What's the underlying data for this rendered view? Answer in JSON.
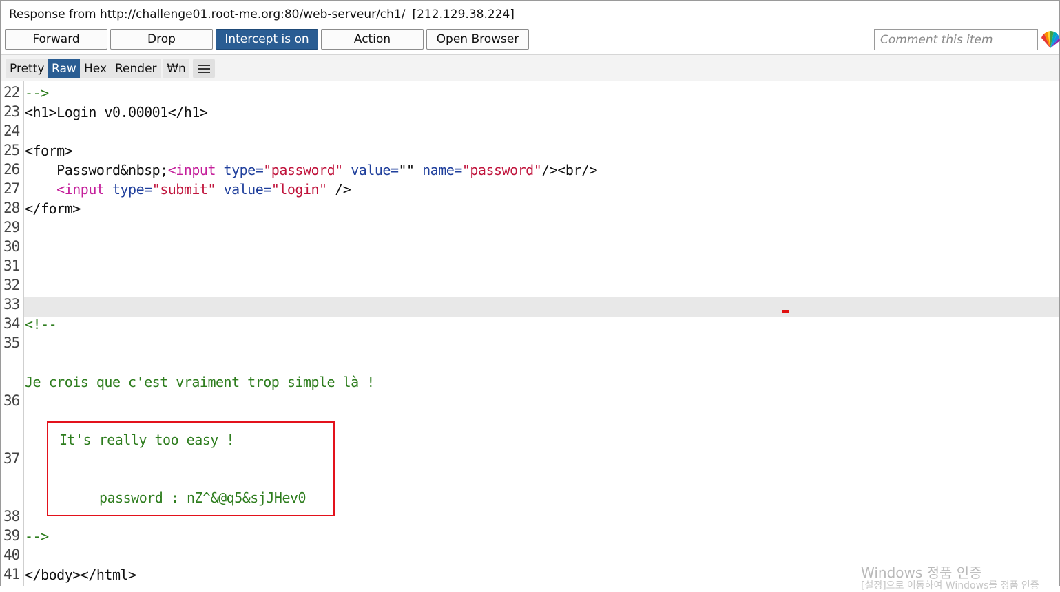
{
  "header": {
    "response_title": "Response from http://challenge01.root-me.org:80/web-serveur/ch1/",
    "ip": "[212.129.38.224]"
  },
  "toolbar": {
    "forward": "Forward",
    "drop": "Drop",
    "intercept": "Intercept is on",
    "action": "Action",
    "open_browser": "Open Browser",
    "comment_placeholder": "Comment this item"
  },
  "view_tabs": {
    "pretty": "Pretty",
    "raw": "Raw",
    "hex": "Hex",
    "render": "Render",
    "newline": "₩n"
  },
  "lines": {
    "n22": "22",
    "n23": "23",
    "n24": "24",
    "n25": "25",
    "n26": "26",
    "n27": "27",
    "n28": "28",
    "n29": "29",
    "n30": "30",
    "n31": "31",
    "n32": "32",
    "n33": "33",
    "n34": "34",
    "n35": "35",
    "n36": "36",
    "n37": "37",
    "n38": "38",
    "n39": "39",
    "n40": "40",
    "n41": "41"
  },
  "code": {
    "comment_close": "-->",
    "h1_open": "<h1>",
    "h1_text": "Login v0.00001",
    "h1_close": "</h1>",
    "form_open": "<form>",
    "pwd_label": "Password&nbsp;",
    "input_tag": "<input",
    "type_attr": "type=",
    "type_password": "\"password\"",
    "value_attr": "value=",
    "value_empty": "\"\"",
    "name_attr": "name=",
    "name_password": "\"password\"",
    "self_close_br": "/><br/>",
    "type_submit": "\"submit\"",
    "value_login": "\"login\"",
    "self_close": "/>",
    "form_close": "</form>",
    "comment_open": "<!--",
    "french": "Je crois que c'est vraiment trop simple là !",
    "english": "It's really too easy !",
    "password_line": "password : nZ^&@q5&sjJHev0",
    "comment_end": "-->",
    "body_html_close": "</body></html>"
  },
  "watermark": {
    "title": "Windows 정품 인증",
    "subtitle": "[설정]으로 이동하여 Windows를 정품 인증"
  },
  "colors": {
    "intercept_on": "#2a5d93",
    "tag": "#c41e9a",
    "attr": "#1f3f9c",
    "value": "#c0143c",
    "comment": "#2e7d1e",
    "highlight_box": "#e3121c"
  }
}
